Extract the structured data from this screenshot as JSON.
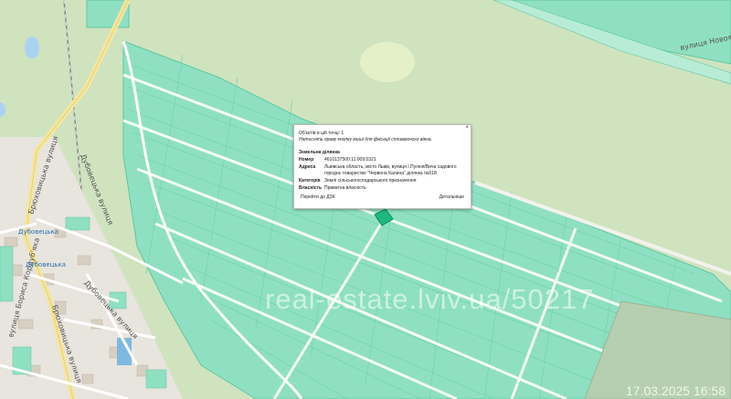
{
  "map": {
    "colors": {
      "forest": "#cfe3bf",
      "parcel": "#8fe0c2",
      "parcel_edge": "#5fc7a0",
      "road": "#ffffff",
      "main_road": "#f5e6a0",
      "building": "#d8cfc3",
      "selected_parcel": "#1fb87f"
    },
    "street_labels": {
      "dubovetska_1": "Дубовецька вулиця",
      "dubovetska_2": "Дубовецька вулиця",
      "bryukhovytska_1": "Брюховицька вулиця",
      "bryukhovytska_2": "Брюховицька вулиця",
      "bondarenko": "вулиця Бориса Кордуб'яка",
      "novoyavorivska": "вулиця Новояворівська"
    },
    "bus_stops": {
      "stop_1": "Дубовецька",
      "stop_2": "Дубовецька"
    }
  },
  "popup": {
    "count": "Об'єктів в цій точці: 1",
    "hint": "Натисніть праву кнопку миші для фіксації спливаючого вікна.",
    "section": "Земельна ділянка",
    "rows": [
      {
        "k": "Номер",
        "v": "4610137500:11:009:0321"
      },
      {
        "k": "Адреса",
        "v": "Львівська область, місто Львів, вулиця І.Пулюя/Вича садового городнє товариство \"Червона Калина\" ділянка №018"
      },
      {
        "k": "Категорія",
        "v": "Землі сільськогосподарського призначення"
      },
      {
        "k": "Власність",
        "v": "Приватна власність"
      }
    ],
    "button_dzk": "Перейти до ДЗК",
    "button_details": "Детальніше",
    "close": "×"
  },
  "watermark": "real-estate.lviv.ua/50217",
  "timestamp": "17.03.2025 16:58"
}
